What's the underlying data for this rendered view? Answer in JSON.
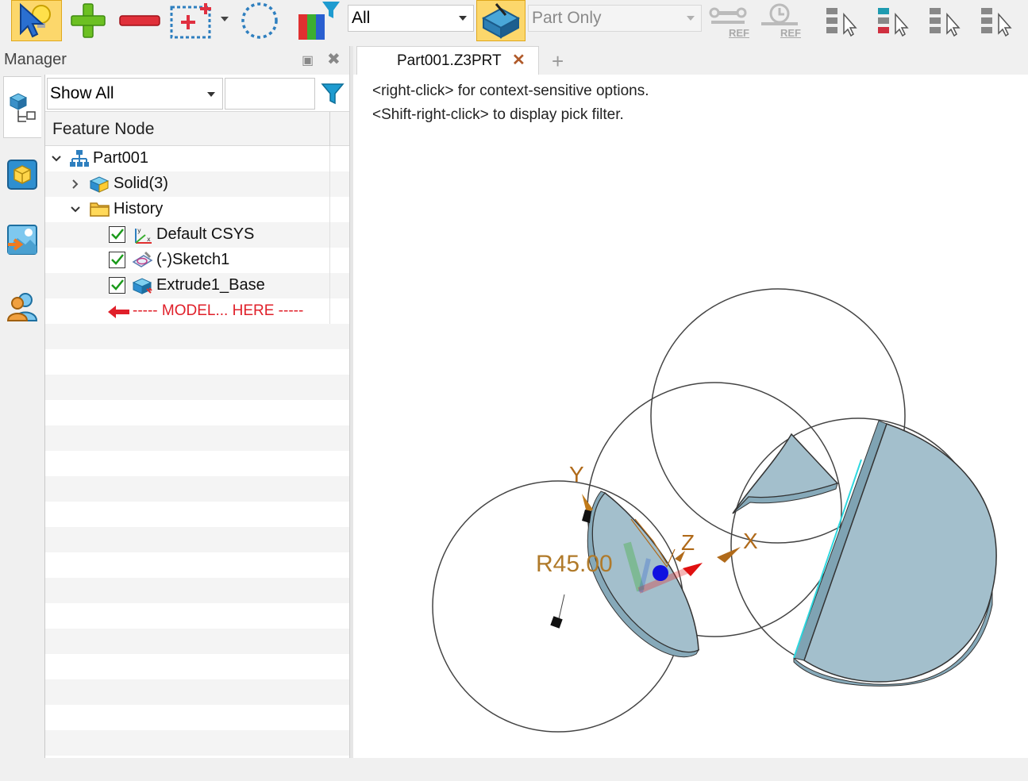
{
  "toolbar": {
    "filter_combo_value": "All",
    "scope_combo_value": "Part Only",
    "ref_label_1": "REF",
    "ref_label_2": "REF",
    "icons": [
      "pick-cursor-icon",
      "add-icon",
      "remove-icon",
      "box-select-icon",
      "lasso-select-icon",
      "color-filter-icon",
      "view-part-icon",
      "ref-chain-icon",
      "ref-clock-icon",
      "tree-pick-icon-1",
      "tree-pick-icon-2",
      "tree-pick-icon-3",
      "tree-pick-icon-4"
    ]
  },
  "manager": {
    "title": "Manager",
    "show_filter_value": "Show All",
    "column_header": "Feature Node",
    "side_tabs": [
      "history-manager-icon",
      "solid-manager-icon",
      "image-manager-icon",
      "user-manager-icon"
    ],
    "tree": [
      {
        "label": "Part001",
        "icon": "assembly-tree-icon",
        "expanded": true
      },
      {
        "label": "Solid(3)",
        "icon": "solid-icon",
        "expanded": false
      },
      {
        "label": "History",
        "icon": "folder-icon",
        "expanded": true
      },
      {
        "label": "Default CSYS",
        "icon": "csys-icon",
        "checked": true
      },
      {
        "label": "(-)Sketch1",
        "icon": "sketch-icon",
        "checked": true
      },
      {
        "label": "Extrude1_Base",
        "icon": "extrude-icon",
        "checked": true
      },
      {
        "label": "----- MODEL... HERE -----",
        "icon": "rollback-arrow-icon"
      }
    ]
  },
  "document": {
    "tab_label": "Part001.Z3PRT",
    "hints": [
      "<right-click> for context-sensitive options.",
      "<Shift-right-click> to display pick filter."
    ]
  },
  "viewport": {
    "dimension_label": "R45.00",
    "axis_x": "X",
    "axis_y": "Y",
    "axis_z": "Z",
    "solid_color": "#a3bfcc",
    "axis_color": "#b06a1a",
    "dimension_color": "#b07a2a"
  }
}
